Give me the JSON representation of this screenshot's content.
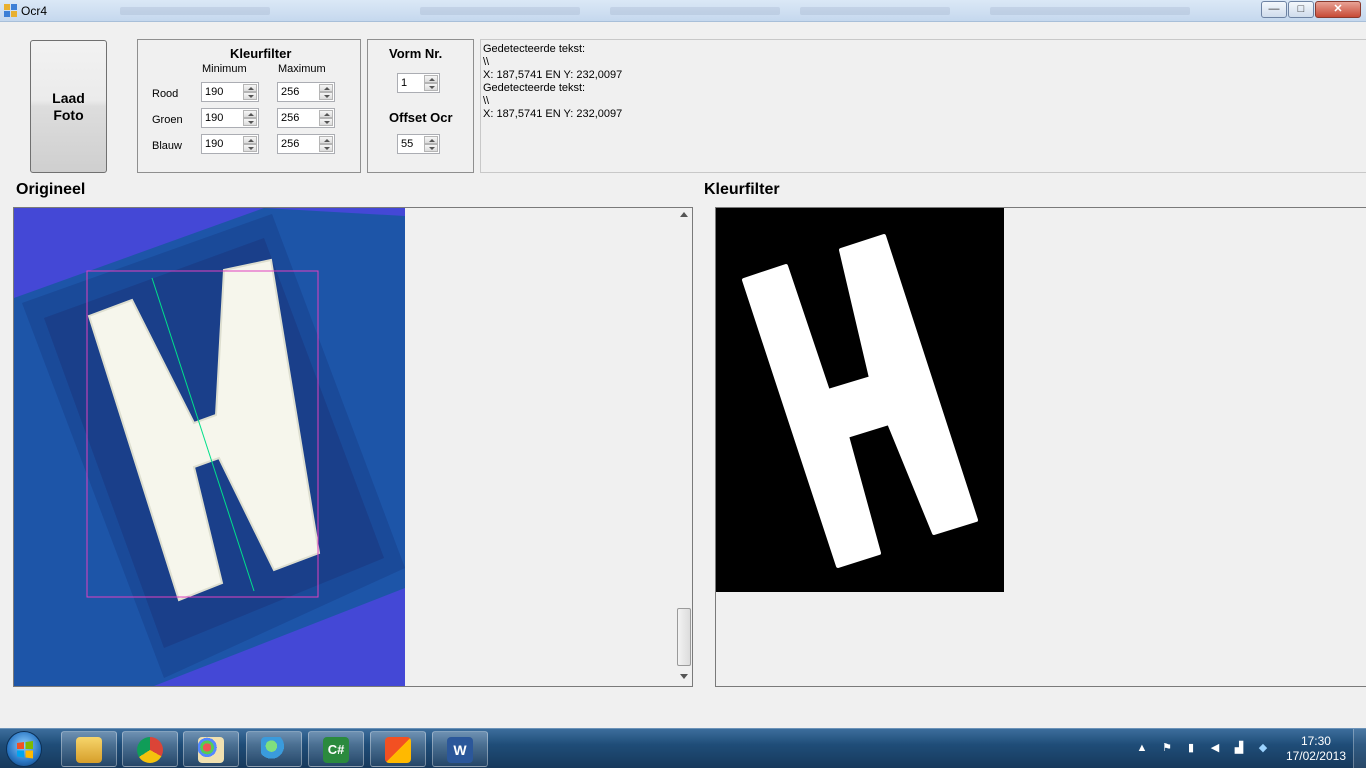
{
  "window": {
    "title": "Ocr4"
  },
  "title_controls": {
    "minimize": "—",
    "maximize": "□",
    "close": "✕"
  },
  "load_button": {
    "label": "Laad\nFoto"
  },
  "kleurfilter_group": {
    "title": "Kleurfilter",
    "col_min": "Minimum",
    "col_max": "Maximum",
    "rows": [
      {
        "label": "Rood",
        "min": "190",
        "max": "256"
      },
      {
        "label": "Groen",
        "min": "190",
        "max": "256"
      },
      {
        "label": "Blauw",
        "min": "190",
        "max": "256"
      }
    ]
  },
  "vorm_group": {
    "vorm_title": "Vorm Nr.",
    "vorm_value": "1",
    "offset_title": "Offset Ocr",
    "offset_value": "55"
  },
  "output_text": {
    "lines": [
      "Gedetecteerde tekst:",
      "\\\\",
      "",
      "X: 187,5741 EN Y: 232,0097",
      "Gedetecteerde tekst:",
      "\\\\",
      "",
      "X: 187,5741 EN Y: 232,0097"
    ]
  },
  "labels": {
    "original": "Origineel",
    "filtered": "Kleurfilter"
  },
  "image_colors": {
    "background": "#4448d6",
    "tile": "#1b4fa0",
    "letter": "#f6f6ec",
    "bbox": "#e040c0",
    "axis_line": "#00e08a"
  },
  "taskbar": {
    "apps": [
      "explorer-icon",
      "chrome-icon",
      "paint-icon",
      "messenger-icon",
      "csharp-icon",
      "office-icon",
      "word-icon"
    ],
    "clock_time": "17:30",
    "clock_date": "17/02/2013"
  }
}
